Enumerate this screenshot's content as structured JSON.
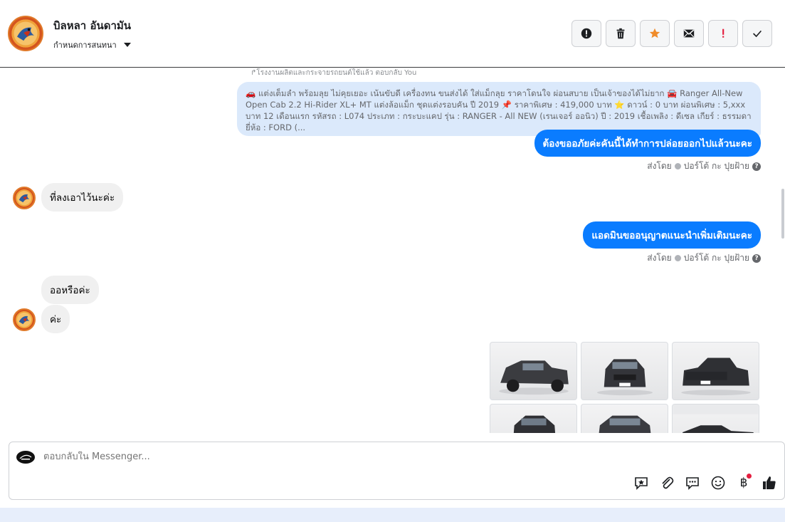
{
  "header": {
    "contact_name": "บิลหลา อันดามัน",
    "assign_label": "กำหนดการสนทนา",
    "actions": [
      {
        "name": "report-spam-button",
        "icon": "alert-circle-icon"
      },
      {
        "name": "delete-button",
        "icon": "trash-icon"
      },
      {
        "name": "star-button",
        "icon": "star-icon",
        "color": "#f08c2a"
      },
      {
        "name": "mark-unread-button",
        "icon": "envelope-icon"
      },
      {
        "name": "follow-up-button",
        "icon": "exclamation-icon",
        "color": "#e41e3f"
      },
      {
        "name": "done-button",
        "icon": "check-icon"
      }
    ]
  },
  "thread": {
    "reply_note": "↱โรงงานผลิตและกระจายรถยนต์ใช้แล้ว ตอบกลับ You",
    "quoted_message": "🚗 แต่งเต็มลำ พร้อมลุย ไม่คุยเยอะ เน้นขับดี เครื่องทน ขนส่งได้ ใส่แม็กลุย ราคาโดนใจ ผ่อนสบาย เป็นเจ้าของได้ไม่ยาก 🚘 Ranger All-New Open Cab 2.2 Hi-Rider XL+ MT แต่งล้อแม็ก ชุดแต่งรอบคัน ปี 2019 📌 ราคาพิเศษ : 419,000 บาท ⭐ ดาวน์ : 0 บาท ผ่อนพิเศษ : 5,xxx บาท 12 เดือนแรก รหัสรถ : L074 ประเภท : กระบะแคป รุ่น : RANGER - All NEW (เรนเจอร์ ออนิว) ปี : 2019 เชื้อเพลิง : ดีเซล เกียร์ : ธรรมดา ยี่ห้อ : FORD (...",
    "messages": [
      {
        "direction": "out",
        "text": "ต้องขออภัยค่ะคันนี้ได้ทำการปล่อยออกไปแล้วนะคะ"
      },
      {
        "direction": "in",
        "text": "ที่ลงเอาไว้นะค่ะ"
      },
      {
        "direction": "out",
        "text": "แอดมินขออนุญาตแนะนำเพิ่มเติมนะคะ"
      },
      {
        "direction": "in",
        "text": "ออหรือค่ะ"
      },
      {
        "direction": "in",
        "text": "ค่ะ"
      }
    ],
    "sent_by_label": "ส่งโดย",
    "sent_by_name": "ปอร์โต้ กะ ปุยฝ้าย",
    "help_symbol": "?"
  },
  "composer": {
    "placeholder": "ตอบกลับใน Messenger...",
    "tools": [
      "sticker-star-icon",
      "paperclip-icon",
      "chat-bubble-icon",
      "emoji-icon",
      "baht-icon",
      "thumbs-up-icon"
    ],
    "baht_symbol": "฿"
  },
  "colors": {
    "outgoing": "#0a7cff",
    "incoming": "#f0f0f0",
    "quoted_bg": "#dbe9fb",
    "notification": "#e41e3f"
  }
}
